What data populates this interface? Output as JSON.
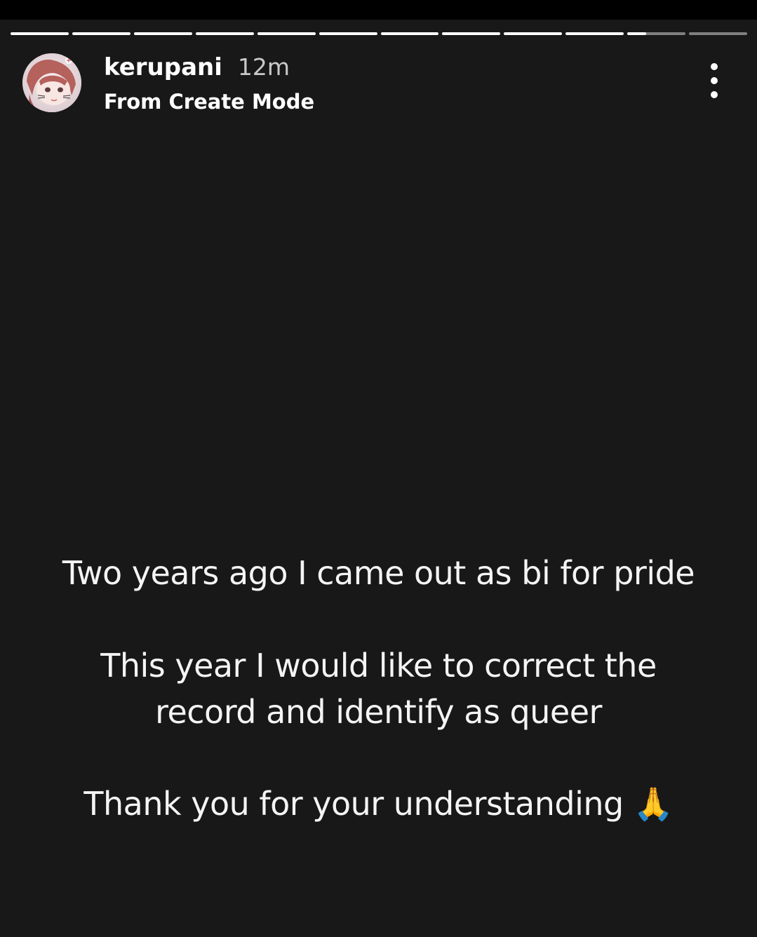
{
  "story": {
    "segments_total": 12,
    "segments_completed": 10,
    "current_segment_progress": 0.32
  },
  "header": {
    "username": "kerupani",
    "time_ago": "12m",
    "subtitle": "From Create Mode"
  },
  "icons": {
    "avatar": "profile-avatar",
    "more": "more-options-icon"
  },
  "content": {
    "line1": "Two years ago I came out as bi for pride",
    "line2": "This year I would like to correct the",
    "line3": "record and identify as queer",
    "line4": "Thank you for your understanding",
    "emoji": "🙏"
  },
  "colors": {
    "background": "#181818",
    "progress_done": "#ffffff",
    "progress_pending": "rgba(255,255,255,0.45)"
  }
}
